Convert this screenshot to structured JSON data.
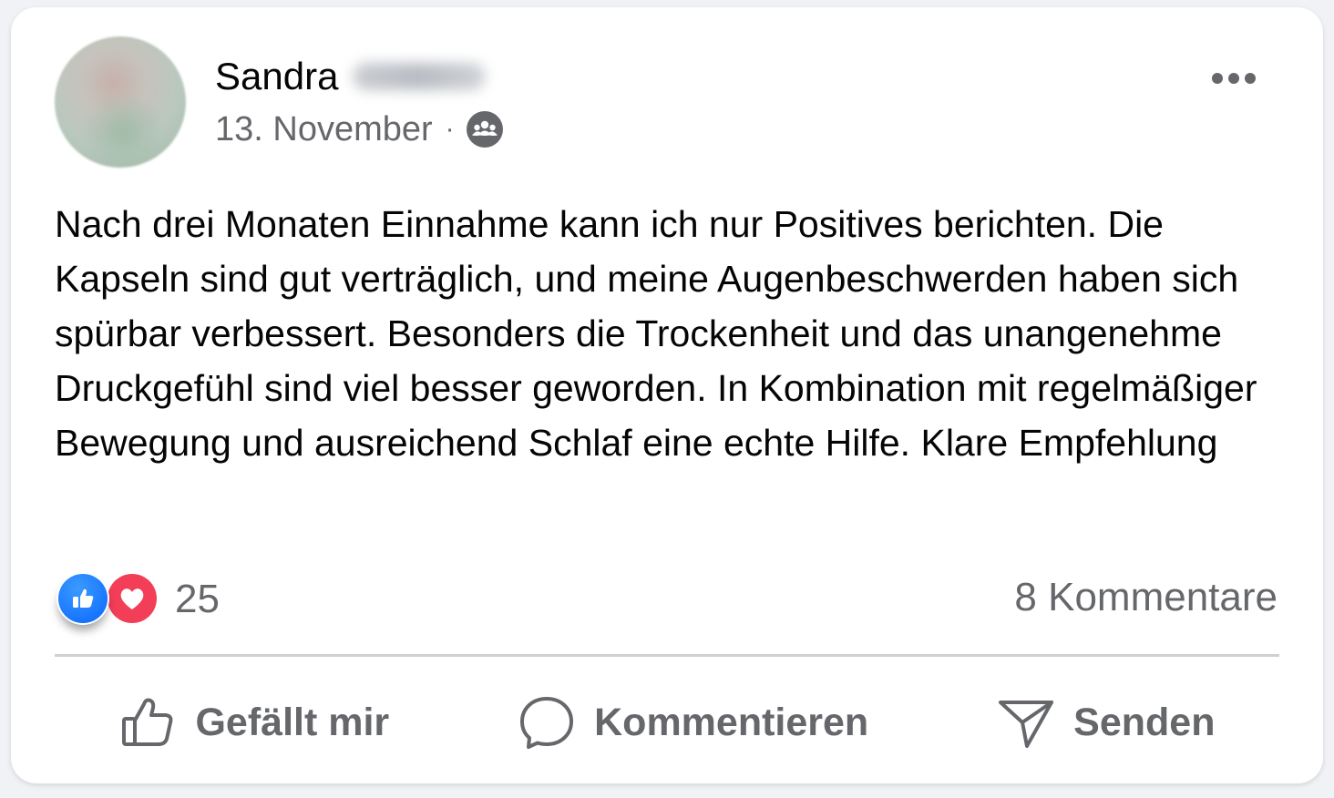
{
  "post": {
    "author": {
      "first_name": "Sandra",
      "avatar_icon": "blurred-avatar"
    },
    "date": "13. November",
    "separator": "·",
    "audience_icon": "group-icon",
    "more_icon": "more-options-icon",
    "text": "Nach drei Monaten Einnahme kann ich nur Positives berichten. Die Kapseln sind gut verträglich, und meine Augenbeschwerden haben sich spürbar verbessert. Besonders die Trockenheit und das unangenehme Druckgefühl sind viel besser geworden. In Kombination mit regelmäßiger Bewegung und ausreichend Schlaf eine echte Hilfe. Klare Empfehlung"
  },
  "stats": {
    "reaction_icons": [
      "like-reaction-icon",
      "love-reaction-icon"
    ],
    "reaction_count": "25",
    "comments": "8 Kommentare"
  },
  "actions": {
    "like": {
      "label": "Gefällt mir",
      "icon": "thumbs-up-icon"
    },
    "comment": {
      "label": "Kommentieren",
      "icon": "comment-bubble-icon"
    },
    "share": {
      "label": "Senden",
      "icon": "send-icon"
    }
  },
  "colors": {
    "like_blue": "#0866ff",
    "love_red": "#f33e58",
    "secondary_text": "#65676b",
    "primary_text": "#050505"
  }
}
